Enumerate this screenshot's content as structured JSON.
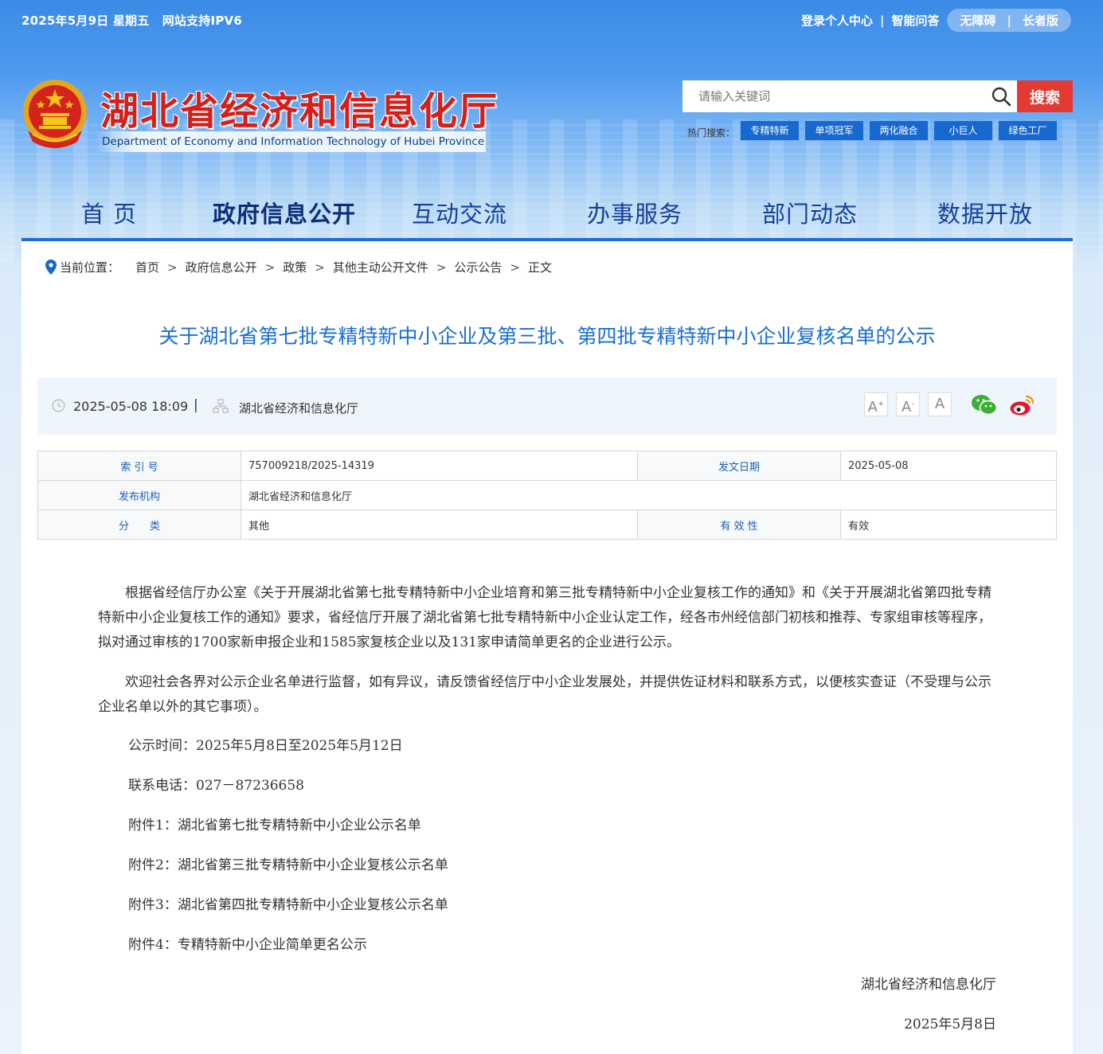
{
  "topbar": {
    "date": "2025年5月9日 星期五",
    "ipv6": "网站支持IPV6",
    "login": "登录个人中心",
    "ai_qa": "智能问答",
    "accessibility": "无障碍",
    "elder": "长者版"
  },
  "header": {
    "title": "湖北省经济和信息化厅",
    "subtitle": "Department of Economy and Information Technology of Hubei Province"
  },
  "search": {
    "placeholder": "请输入关键词",
    "button": "搜索",
    "hot_label": "热门搜索：",
    "hot_tags": [
      "专精特新",
      "单项冠军",
      "两化融合",
      "小巨人",
      "绿色工厂"
    ]
  },
  "nav": [
    "首 页",
    "政府信息公开",
    "互动交流",
    "办事服务",
    "部门动态",
    "数据开放"
  ],
  "breadcrumb": {
    "label": "当前位置：",
    "items": [
      "首页",
      "政府信息公开",
      "政策",
      "其他主动公开文件",
      "公示公告",
      "正文"
    ],
    "separator": ">"
  },
  "article": {
    "title": "关于湖北省第七批专精特新中小企业及第三批、第四批专精特新中小企业复核名单的公示",
    "datetime": "2025-05-08 18:09",
    "source": "湖北省经济和信息化厅",
    "font_buttons": [
      "A",
      "A",
      "A"
    ]
  },
  "info_table": {
    "index_label": "索 引 号",
    "index_value": "757009218/2025-14319",
    "date_label": "发文日期",
    "date_value": "2025-05-08",
    "org_label": "发布机构",
    "org_value": "湖北省经济和信息化厅",
    "category_label": "分　　类",
    "category_value": "其他",
    "validity_label": "有 效 性",
    "validity_value": "有效"
  },
  "body": {
    "para1": "根据省经信厅办公室《关于开展湖北省第七批专精特新中小企业培育和第三批专精特新中小企业复核工作的通知》和《关于开展湖北省第四批专精特新中小企业复核工作的通知》要求，省经信厅开展了湖北省第七批专精特新中小企业认定工作，经各市州经信部门初核和推荐、专家组审核等程序，拟对通过审核的1700家新申报企业和1585家复核企业以及131家申请简单更名的企业进行公示。",
    "para2": "欢迎社会各界对公示企业名单进行监督，如有异议，请反馈省经信厅中小企业发展处，并提供佐证材料和联系方式，以便核实查证（不受理与公示企业名单以外的其它事项）。",
    "period": "公示时间：2025年5月8日至2025年5月12日",
    "phone": "联系电话：027－87236658",
    "attachments": [
      "附件1：湖北省第七批专精特新中小企业公示名单",
      "附件2：湖北省第三批专精特新中小企业复核公示名单",
      "附件3：湖北省第四批专精特新中小企业复核公示名单",
      "附件4：专精特新中小企业简单更名公示"
    ],
    "signature": "湖北省经济和信息化厅",
    "sign_date": "2025年5月8日"
  },
  "colors": {
    "brand_red": "#d81e18",
    "nav_blue": "#14409a",
    "title_blue": "#1a6fd0",
    "search_red": "#e33a33"
  }
}
